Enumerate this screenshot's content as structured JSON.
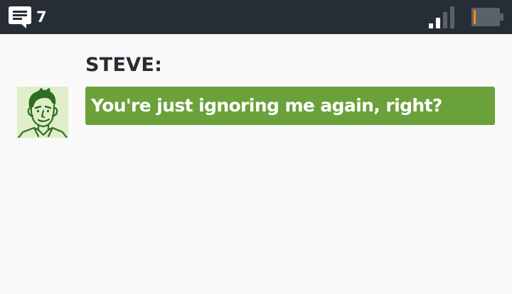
{
  "status_bar": {
    "messages_icon": "chat-bubble-icon",
    "message_count": "7",
    "signal_icon": "signal-bars-icon",
    "signal_level": 0.5,
    "battery_icon": "battery-icon",
    "battery_level": 0.1,
    "colors": {
      "background": "#262d36",
      "battery_charge": "#f28c0f",
      "battery_body": "#5b6169"
    }
  },
  "conversation": {
    "sender_name": "STEVE:",
    "avatar": "steve-avatar",
    "message": "You're just ignoring me again, right?",
    "colors": {
      "bubble": "#6aa13a",
      "avatar_background": "#dfeec9",
      "avatar_line": "#2f6d21"
    }
  }
}
